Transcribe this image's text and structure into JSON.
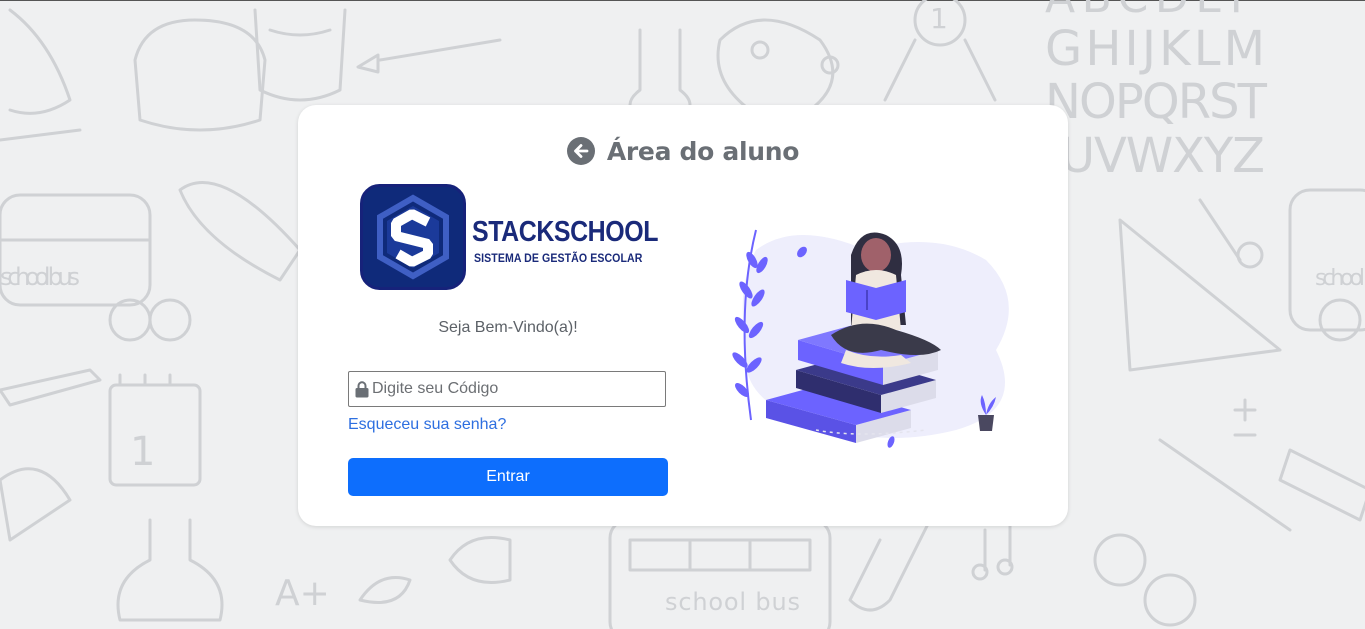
{
  "header": {
    "title": "Área do aluno",
    "back_icon": "arrow-left-circle-icon"
  },
  "logo": {
    "name": "STACKSCHOOL",
    "subtitle": "SISTEMA DE GESTÃO ESCOLAR",
    "colors": {
      "navy": "#0f2a7a",
      "border": "#16227a"
    }
  },
  "welcome_text": "Seja Bem-Vindo(a)!",
  "code_field": {
    "placeholder": "Digite seu Código",
    "value": "",
    "icon": "lock-icon"
  },
  "forgot_password_link": "Esqueceu sua senha?",
  "submit_button": "Entrar",
  "background": {
    "doodle_texts": [
      "ABCDEF",
      "GHIJKLM",
      "NOPQRST",
      "UVWXYZ",
      "school bus",
      "school bus",
      "school",
      "A+",
      "1",
      "1"
    ]
  },
  "colors": {
    "primary": "#0d6efd",
    "link": "#2e6fe0",
    "title": "#6a6f75",
    "illustration_accent": "#6c63ff"
  }
}
